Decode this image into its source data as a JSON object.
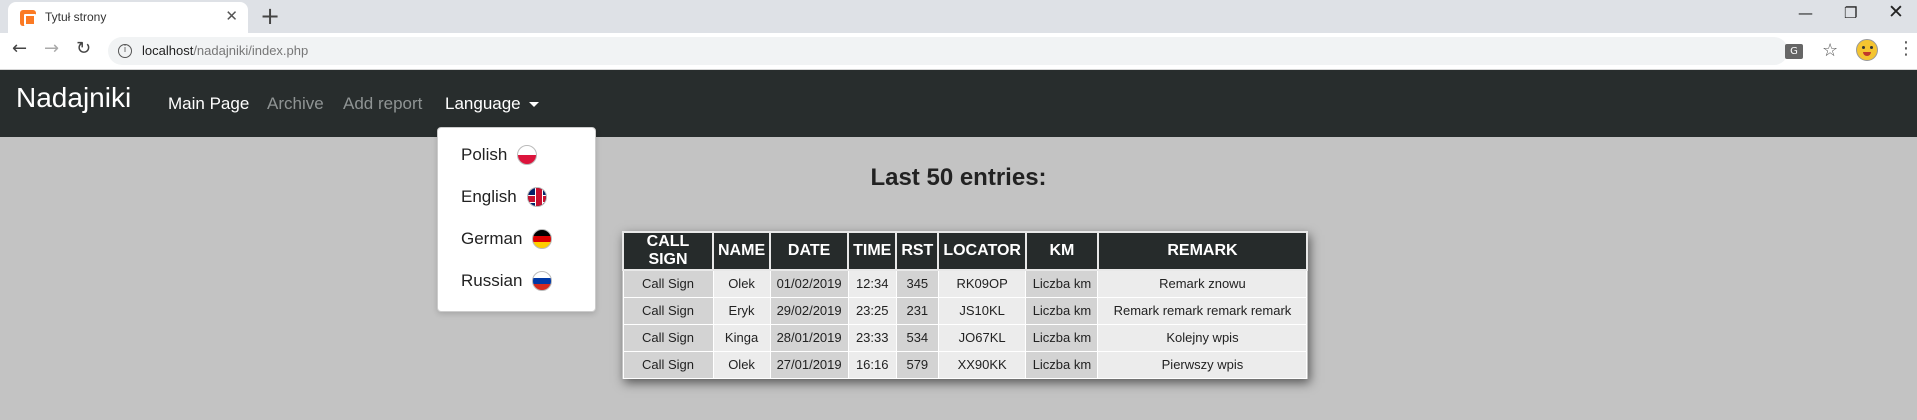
{
  "browser": {
    "tab_title": "Tytuł strony",
    "url_host": "localhost",
    "url_path": "/nadajniki/index.php",
    "icons": [
      "xampp-favicon",
      "close-icon",
      "plus-icon",
      "back-arrow-icon",
      "forward-arrow-icon",
      "reload-icon",
      "info-icon",
      "translate-icon",
      "star-icon",
      "profile-icon",
      "kebab-menu-icon",
      "minimize-icon",
      "restore-icon",
      "window-close-icon"
    ]
  },
  "navbar": {
    "brand": "Nadajniki",
    "links": {
      "main": "Main Page",
      "archive": "Archive",
      "report": "Add report",
      "language": "Language"
    }
  },
  "language_menu": {
    "items": [
      {
        "label": "Polish",
        "flag": "flag-pl-icon"
      },
      {
        "label": "English",
        "flag": "flag-gb-icon"
      },
      {
        "label": "German",
        "flag": "flag-de-icon"
      },
      {
        "label": "Russian",
        "flag": "flag-ru-icon"
      }
    ]
  },
  "main": {
    "heading": "Last 50 entries:"
  },
  "table": {
    "headers": [
      "CALL SIGN",
      "NAME",
      "DATE",
      "TIME",
      "RST",
      "LOCATOR",
      "KM",
      "REMARK"
    ],
    "rows": [
      [
        "Call Sign",
        "Olek",
        "01/02/2019",
        "12:34",
        "345",
        "RK09OP",
        "Liczba km",
        "Remark znowu"
      ],
      [
        "Call Sign",
        "Eryk",
        "29/02/2019",
        "23:25",
        "231",
        "JS10KL",
        "Liczba km",
        "Remark remark remark remark"
      ],
      [
        "Call Sign",
        "Kinga",
        "28/01/2019",
        "23:33",
        "534",
        "JO67KL",
        "Liczba km",
        "Kolejny wpis"
      ],
      [
        "Call Sign",
        "Olek",
        "27/01/2019",
        "16:16",
        "579",
        "XX90KK",
        "Liczba km",
        "Pierwszy wpis"
      ]
    ]
  },
  "colors": {
    "navbar_bg": "#282d2d",
    "page_bg": "#c3c3c3",
    "table_header_bg": "#262b2b",
    "muted_link": "#8f9494"
  }
}
